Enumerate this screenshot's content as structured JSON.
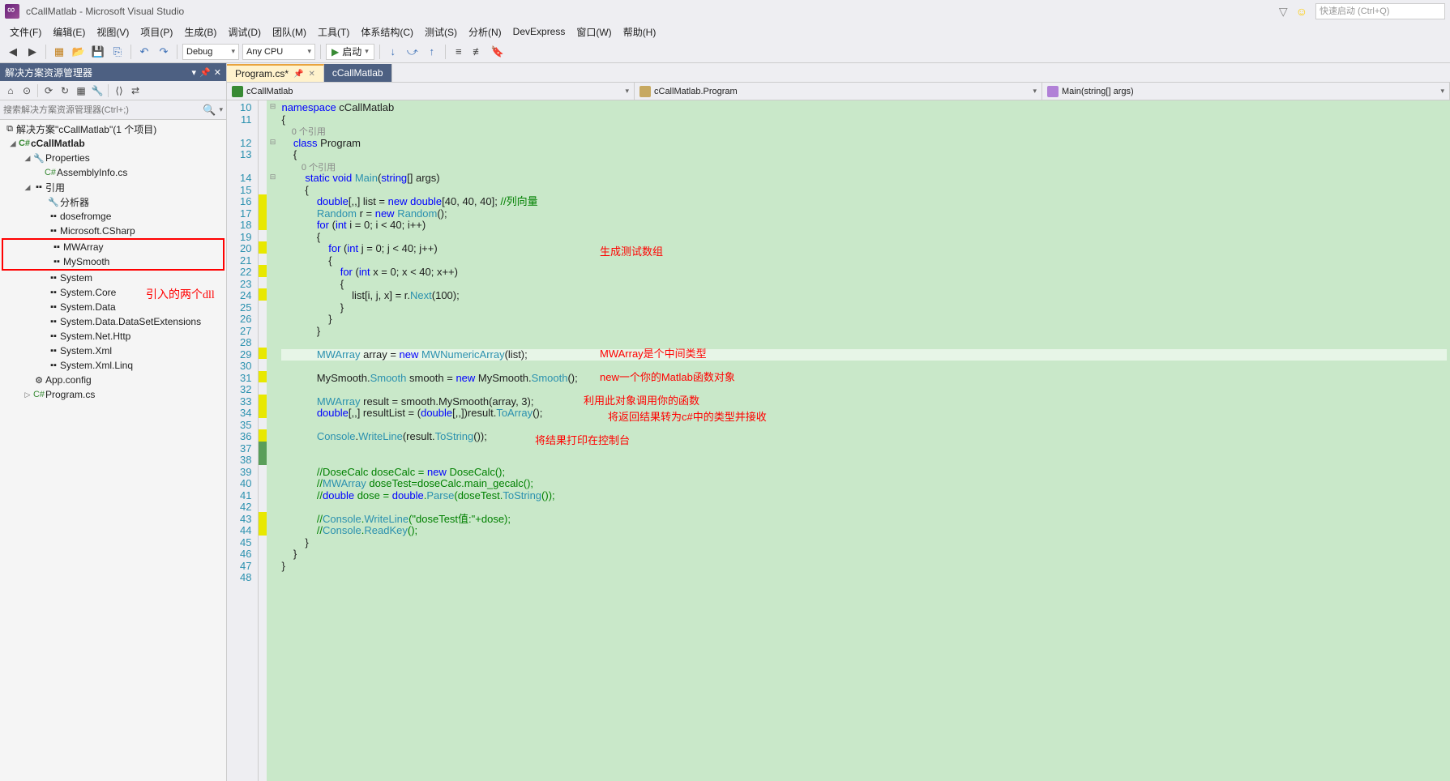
{
  "window": {
    "title": "cCallMatlab - Microsoft Visual Studio"
  },
  "quicklaunch": {
    "placeholder": "快速启动 (Ctrl+Q)"
  },
  "menu": {
    "file": "文件(F)",
    "edit": "编辑(E)",
    "view": "视图(V)",
    "project": "项目(P)",
    "build": "生成(B)",
    "debug": "调试(D)",
    "team": "团队(M)",
    "tools": "工具(T)",
    "arch": "体系结构(C)",
    "test": "测试(S)",
    "analyze": "分析(N)",
    "devexpress": "DevExpress",
    "window": "窗口(W)",
    "help": "帮助(H)"
  },
  "toolbar": {
    "config": "Debug",
    "platform": "Any CPU",
    "start": "启动"
  },
  "explorer": {
    "title": "解决方案资源管理器",
    "search_placeholder": "搜索解决方案资源管理器(Ctrl+;)",
    "solution": "解决方案\"cCallMatlab\"(1 个项目)",
    "project": "cCallMatlab",
    "properties": "Properties",
    "assemblyinfo": "AssemblyInfo.cs",
    "references": "引用",
    "refs": {
      "analyzer": "分析器",
      "dosefromge": "dosefromge",
      "mscharp": "Microsoft.CSharp",
      "mwarray": "MWArray",
      "mysmooth": "MySmooth",
      "system": "System",
      "syscore": "System.Core",
      "sysdata": "System.Data",
      "sysdataext": "System.Data.DataSetExtensions",
      "sysnethttp": "System.Net.Http",
      "sysxml": "System.Xml",
      "sysxmllinq": "System.Xml.Linq"
    },
    "appconfig": "App.config",
    "programcs": "Program.cs"
  },
  "annotations": {
    "dll": "引入的两个dll",
    "testarray": "生成测试数组",
    "mwarray": "MWArray是个中间类型",
    "newobj": "new一个你的Matlab函数对象",
    "callfunc": "利用此对象调用你的函数",
    "convert": "将返回结果转为c#中的类型并接收",
    "printout": "将结果打印在控制台"
  },
  "tabs": {
    "program": "Program.cs*",
    "ccall": "cCallMatlab"
  },
  "nav": {
    "proj": "cCallMatlab",
    "class": "cCallMatlab.Program",
    "member": "Main(string[] args)"
  },
  "code": {
    "ref0": "0 个引用",
    "l10": "namespace cCallMatlab",
    "l14": "        static void Main(string[] args)",
    "l16": "            double[,,] list = new double[40, 40, 40]; //列向量",
    "l17": "            Random r = new Random();",
    "l18": "            for (int i = 0; i < 40; i++)",
    "l20": "                for (int j = 0; j < 40; j++)",
    "l22": "                    for (int x = 0; x < 40; x++)",
    "l24": "                        list[i, j, x] = r.Next(100);",
    "l29": "            MWArray array = new MWNumericArray(list);",
    "l31": "            MySmooth.Smooth smooth = new MySmooth.Smooth();",
    "l33": "            MWArray result = smooth.MySmooth(array, 3);",
    "l34": "            double[,,] resultList = (double[,,])result.ToArray();",
    "l36": "            Console.WriteLine(result.ToString());",
    "l39": "            //DoseCalc doseCalc = new DoseCalc();",
    "l40": "            //MWArray doseTest=doseCalc.main_gecalc();",
    "l41": "            //double dose = double.Parse(doseTest.ToString());",
    "l43": "            //Console.WriteLine(\"doseTest值:\"+dose);",
    "l44": "            //Console.ReadKey();"
  }
}
